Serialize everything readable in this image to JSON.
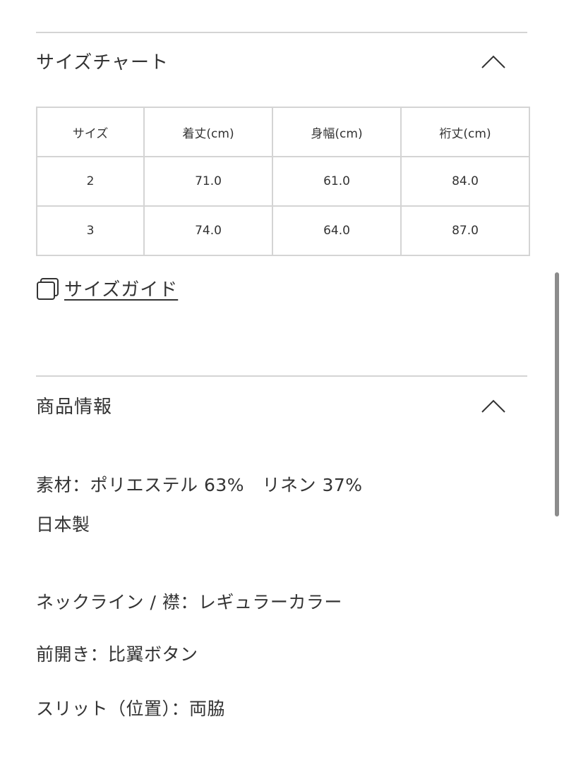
{
  "size_chart": {
    "title": "サイズチャート",
    "toggle_icon": "chevron-up-icon",
    "columns": [
      "サイズ",
      "着丈(cm)",
      "身幅(cm)",
      "裄丈(cm)"
    ],
    "rows": [
      [
        "2",
        "71.0",
        "61.0",
        "84.0"
      ],
      [
        "3",
        "74.0",
        "64.0",
        "87.0"
      ]
    ],
    "size_guide_icon": "copy-window-icon",
    "size_guide_label": "サイズガイド"
  },
  "product_info": {
    "title": "商品情報",
    "toggle_icon": "chevron-up-icon",
    "material": "素材：ポリエステル 63%　リネン 37%",
    "origin": "日本製",
    "neckline": "ネックライン / 襟：レギュラーカラー",
    "front_opening": "前開き：比翼ボタン",
    "slit": "スリット（位置）：両脇"
  },
  "colors": {
    "text": "#333333",
    "divider": "#d4d4d4",
    "scrollbar": "#8c8c8c"
  }
}
